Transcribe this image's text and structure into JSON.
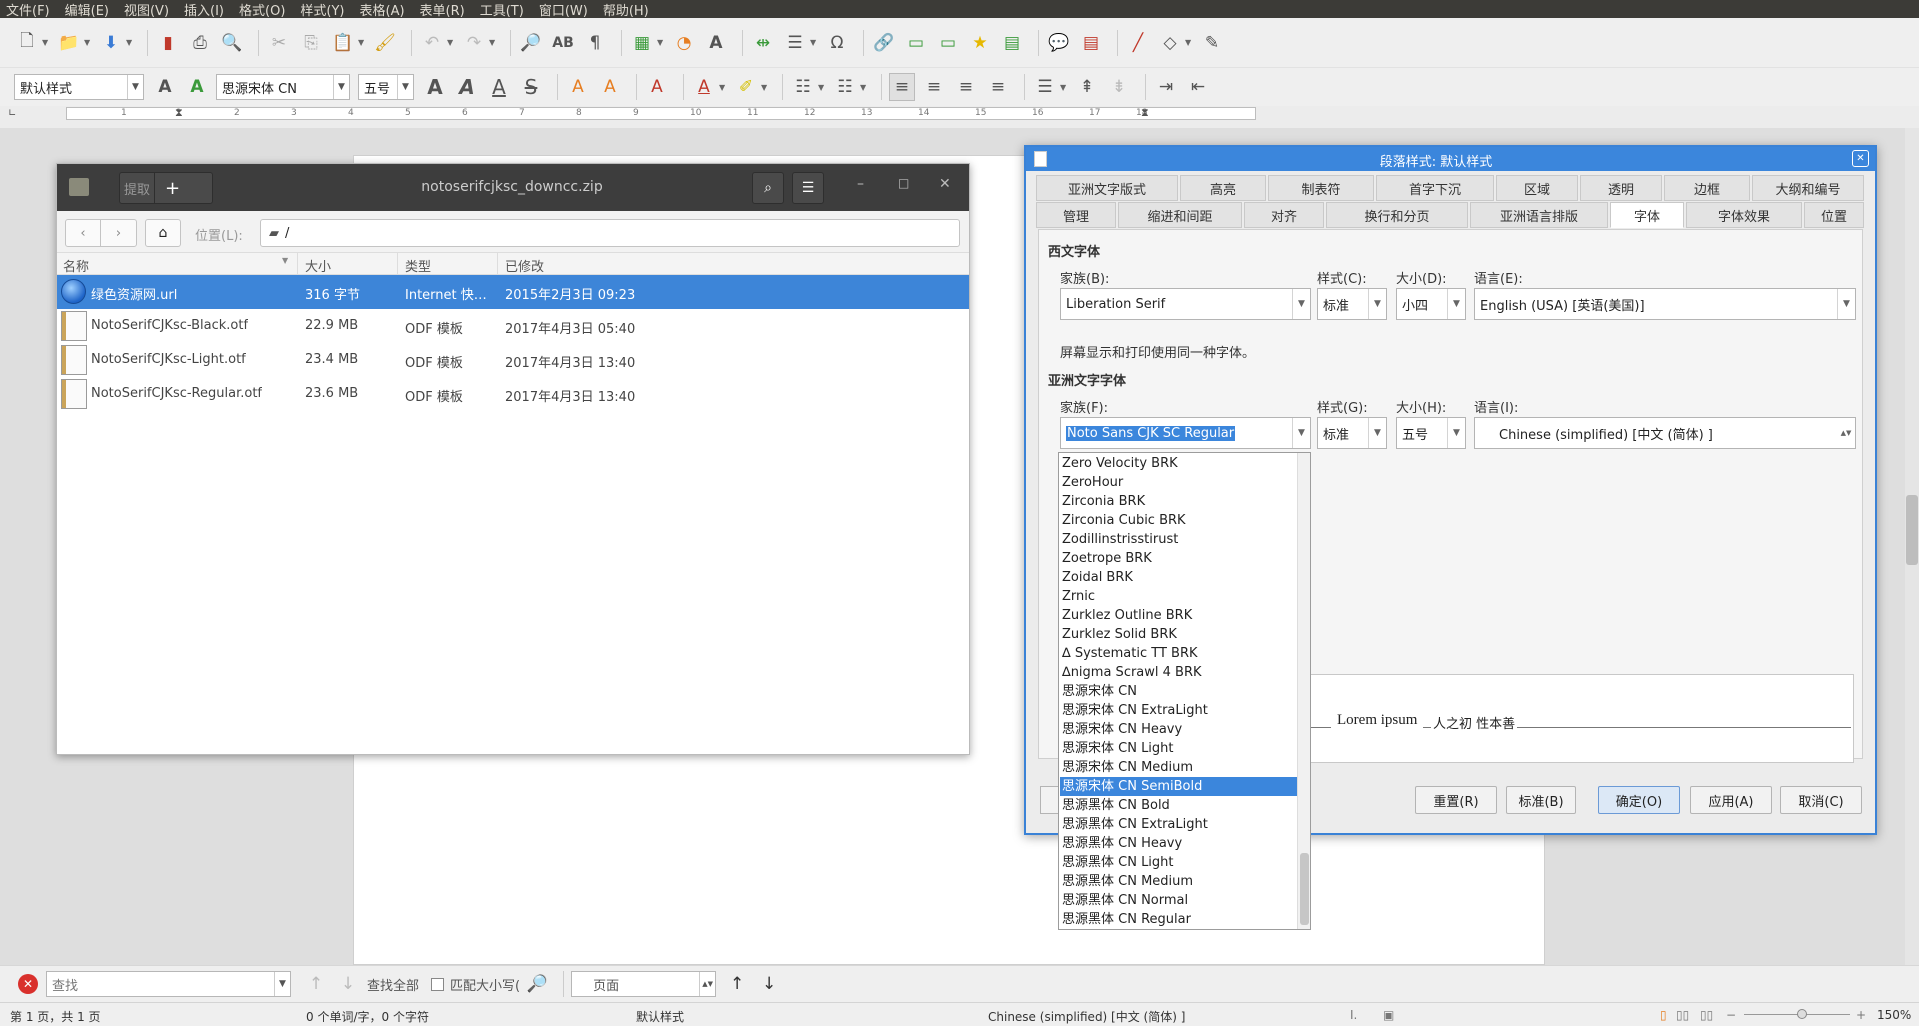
{
  "menubar": {
    "items": [
      "文件(F)",
      "编辑(E)",
      "视图(V)",
      "插入(I)",
      "格式(O)",
      "样式(Y)",
      "表格(A)",
      "表单(R)",
      "工具(T)",
      "窗口(W)",
      "帮助(H)"
    ]
  },
  "toolbar2": {
    "paragraph_style": "默认样式",
    "font_name": "思源宋体 CN",
    "font_size": "五号"
  },
  "ruler": {
    "marks": [
      "1",
      "1",
      "2",
      "3",
      "4",
      "5",
      "6",
      "7",
      "8",
      "9",
      "10",
      "11",
      "12",
      "13",
      "14",
      "15",
      "16",
      "17",
      "18"
    ]
  },
  "file_manager": {
    "title": "notoserifcjksc_downcc.zip",
    "extract_label": "提取",
    "location_label": "位置(L):",
    "path": "/",
    "columns": {
      "name": "名称",
      "size": "大小",
      "type": "类型",
      "modified": "已修改"
    },
    "files": [
      {
        "name": "绿色资源网.url",
        "size": "316 字节",
        "type": "Internet 快捷...",
        "modified": "2015年2月3日 09:23",
        "icon": "globe-icon"
      },
      {
        "name": "NotoSerifCJKsc-Black.otf",
        "size": "22.9 MB",
        "type": "ODF 模板",
        "modified": "2017年4月3日 05:40",
        "icon": "document-icon"
      },
      {
        "name": "NotoSerifCJKsc-Light.otf",
        "size": "23.4 MB",
        "type": "ODF 模板",
        "modified": "2017年4月3日 13:40",
        "icon": "document-icon"
      },
      {
        "name": "NotoSerifCJKsc-Regular.otf",
        "size": "23.6 MB",
        "type": "ODF 模板",
        "modified": "2017年4月3日 13:40",
        "icon": "document-icon"
      }
    ]
  },
  "dialog": {
    "title": "段落样式: 默认样式",
    "tabs_row1": [
      "亚洲文字版式",
      "高亮",
      "制表符",
      "首字下沉",
      "区域",
      "透明",
      "边框",
      "大纲和编号"
    ],
    "tabs_row2": [
      "管理",
      "缩进和间距",
      "对齐",
      "换行和分页",
      "亚洲语言排版",
      "字体",
      "字体效果",
      "位置"
    ],
    "western": {
      "section": "西文字体",
      "family_label": "家族(B):",
      "style_label": "样式(C):",
      "size_label": "大小(D):",
      "lang_label": "语言(E):",
      "family": "Liberation Serif",
      "style": "标准",
      "size": "小四",
      "language": "English (USA) [英语(美国)]",
      "note": "屏幕显示和打印使用同一种字体。"
    },
    "asian": {
      "section": "亚洲文字字体",
      "family_label": "家族(F):",
      "style_label": "样式(G):",
      "size_label": "大小(H):",
      "lang_label": "语言(I):",
      "family": "Noto Sans CJK SC Regular",
      "style": "标准",
      "size": "五号",
      "language": "Chinese (simplified) [中文 (简体) ]"
    },
    "preview": {
      "latin": "Lorem ipsum",
      "asian": "人之初 性本善"
    },
    "buttons": {
      "reset": "重置(R)",
      "standard": "标准(B)",
      "ok": "确定(O)",
      "apply": "应用(A)",
      "cancel": "取消(C)"
    }
  },
  "font_dropdown": {
    "items": [
      "Zero Velocity BRK",
      "ZeroHour",
      "Zirconia BRK",
      "Zirconia Cubic BRK",
      "Zodillinstrisstirust",
      "Zoetrope BRK",
      "Zoidal BRK",
      "Zrnic",
      "Zurklez Outline BRK",
      "Zurklez Solid BRK",
      "∆ Systematic TT BRK",
      "∆nigma Scrawl 4 BRK",
      "思源宋体 CN",
      "思源宋体 CN ExtraLight",
      "思源宋体 CN Heavy",
      "思源宋体 CN Light",
      "思源宋体 CN Medium",
      "思源宋体 CN SemiBold",
      "思源黑体 CN Bold",
      "思源黑体 CN ExtraLight",
      "思源黑体 CN Heavy",
      "思源黑体 CN Light",
      "思源黑体 CN Medium",
      "思源黑体 CN Normal",
      "思源黑体 CN Regular"
    ],
    "selected": "思源宋体 CN SemiBold"
  },
  "findbar": {
    "placeholder": "查找",
    "find_all": "查找全部",
    "match_case": "匹配大小写(",
    "search_scope": "页面"
  },
  "statusbar": {
    "page": "第 1 页，共 1 页",
    "words": "0 个单词/字，0 个字符",
    "style": "默认样式",
    "language": "Chinese (simplified) [中文 (简体) ]",
    "zoom": "150%"
  },
  "colors": {
    "accent": "#3b86dc",
    "menubar": "#3c3b37",
    "selection": "#3d85d8"
  }
}
